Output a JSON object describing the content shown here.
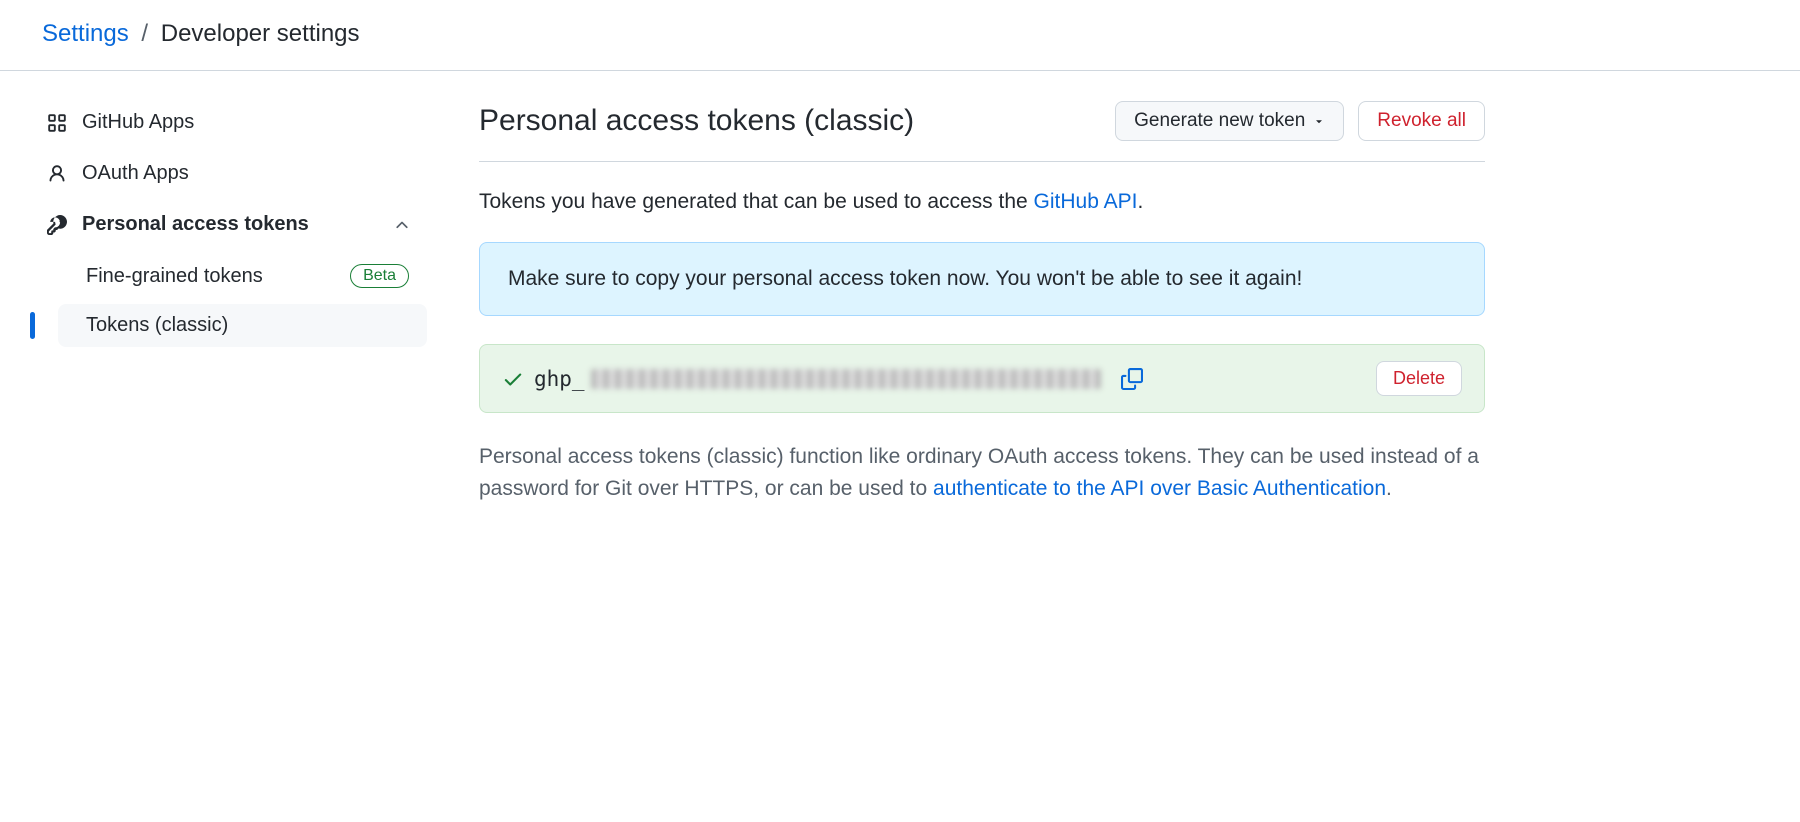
{
  "breadcrumb": {
    "root": "Settings",
    "current": "Developer settings"
  },
  "sidebar": {
    "items": [
      {
        "label": "GitHub Apps"
      },
      {
        "label": "OAuth Apps"
      },
      {
        "label": "Personal access tokens"
      }
    ],
    "sub": [
      {
        "label": "Fine-grained tokens",
        "badge": "Beta"
      },
      {
        "label": "Tokens (classic)"
      }
    ]
  },
  "header": {
    "title": "Personal access tokens (classic)",
    "generate_label": "Generate new token",
    "revoke_label": "Revoke all"
  },
  "desc": {
    "prefix": "Tokens you have generated that can be used to access the ",
    "link": "GitHub API",
    "suffix": "."
  },
  "flash": {
    "message": "Make sure to copy your personal access token now. You won't be able to see it again!"
  },
  "token": {
    "prefix": "ghp_",
    "delete_label": "Delete"
  },
  "help": {
    "text1": "Personal access tokens (classic) function like ordinary OAuth access tokens. They can be used instead of a password for Git over HTTPS, or can be used to ",
    "link": "authenticate to the API over Basic Authentication",
    "suffix": "."
  }
}
